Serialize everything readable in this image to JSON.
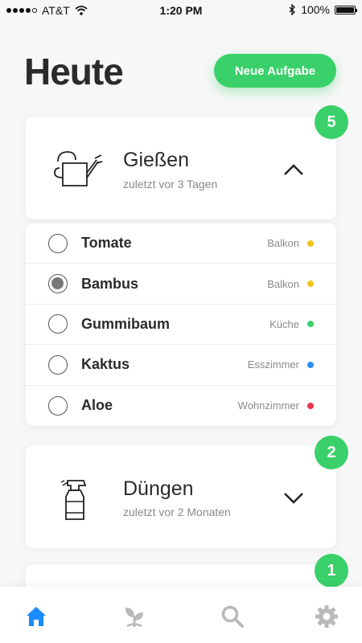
{
  "status_bar": {
    "carrier": "AT&T",
    "time": "1:20 PM",
    "battery": "100%"
  },
  "page": {
    "title": "Heute",
    "new_task_label": "Neue Aufgabe"
  },
  "tasks": [
    {
      "title": "Gießen",
      "subtitle": "zuletzt vor 3 Tagen",
      "count": "5",
      "expanded": true,
      "icon": "watering-can-icon"
    },
    {
      "title": "Düngen",
      "subtitle": "zuletzt vor 2 Monaten",
      "count": "2",
      "expanded": false,
      "icon": "spray-bottle-icon"
    },
    {
      "count": "1"
    }
  ],
  "plants": [
    {
      "name": "Tomate",
      "room": "Balkon",
      "dot_color": "#f5c518",
      "checked": false
    },
    {
      "name": "Bambus",
      "room": "Balkon",
      "dot_color": "#f5c518",
      "checked": true
    },
    {
      "name": "Gummibaum",
      "room": "Küche",
      "dot_color": "#3ad06a",
      "checked": false
    },
    {
      "name": "Kaktus",
      "room": "Esszimmer",
      "dot_color": "#2d8cf0",
      "checked": false
    },
    {
      "name": "Aloe",
      "room": "Wohnzimmer",
      "dot_color": "#e8334a",
      "checked": false
    }
  ],
  "tab_bar": {
    "tabs": [
      {
        "icon": "home-icon",
        "active": true
      },
      {
        "icon": "plant-icon",
        "active": false
      },
      {
        "icon": "search-icon",
        "active": false
      },
      {
        "icon": "settings-icon",
        "active": false
      }
    ]
  },
  "colors": {
    "accent": "#3ad06a",
    "active_tab": "#1a8cff",
    "inactive_tab": "#b9b9b9"
  }
}
